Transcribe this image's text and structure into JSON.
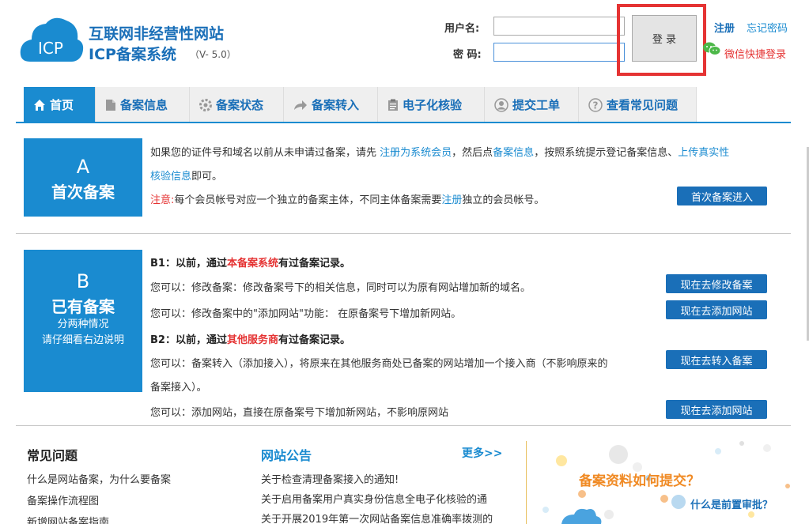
{
  "header": {
    "logo_icon_text": "ICP",
    "title_line1": "互联网非经营性网站",
    "title_line2": "ICP备案系统",
    "version": "（V- 5.0）",
    "username_label": "用户名:",
    "password_label": "密 码:",
    "username_value": "",
    "password_value": "",
    "login_label": "登 录",
    "register_link": "注册",
    "forgot_link": "忘记密码",
    "wechat_link": "微信快捷登录"
  },
  "nav": {
    "items": [
      {
        "label": "首页",
        "icon": "home-icon"
      },
      {
        "label": "备案信息",
        "icon": "document-icon"
      },
      {
        "label": "备案状态",
        "icon": "gear-icon"
      },
      {
        "label": "备案转入",
        "icon": "arrow-forward-icon"
      },
      {
        "label": "电子化核验",
        "icon": "clipboard-icon"
      },
      {
        "label": "提交工单",
        "icon": "user-icon"
      },
      {
        "label": "查看常见问题",
        "icon": "question-icon"
      }
    ]
  },
  "section_a": {
    "letter": "A",
    "title": "首次备案",
    "line1_p1": "如果您的证件号和域名以前从未申请过备案，请先 ",
    "line1_link1": "注册为系统会员",
    "line1_p2": "，然后点",
    "line1_link2": "备案信息",
    "line1_p3": "，按照系统提示登记备案信息、",
    "line1_link3": "上传真实性",
    "line2_link": "核验信息",
    "line2_p": "即可。",
    "note_label": "注意:",
    "note_p1": "每个会员帐号对应一个独立的备案主体，不同主体备案需要",
    "note_link": "注册",
    "note_p2": "独立的会员帐号。",
    "button": "首次备案进入"
  },
  "section_b": {
    "letter": "B",
    "title": "已有备案",
    "sub1": "分两种情况",
    "sub2": "请仔细看右边说明",
    "b1_p1": "B1：以前，通过",
    "b1_red": "本备案系统",
    "b1_p2": "有过备案记录。",
    "b1_line1": "您可以：修改备案：修改备案号下的相关信息，同时可以为原有网站增加新的域名。",
    "b1_line2": "您可以：修改备案中的\"添加网站\"功能：  在原备案号下增加新网站。",
    "b2_p1": "B2：以前，通过",
    "b2_red": "其他服务商",
    "b2_p2": "有过备案记录。",
    "b2_line1": "您可以：备案转入（添加接入），将原来在其他服务商处已备案的网站增加一个接入商（不影响原来的",
    "b2_line1b": "备案接入）。",
    "b2_line2": "您可以：添加网站，直接在原备案号下增加新网站，不影响原网站",
    "btn_modify": "现在去修改备案",
    "btn_add_site1": "现在去添加网站",
    "btn_transfer": "现在去转入备案",
    "btn_add_site2": "现在去添加网站"
  },
  "faq": {
    "title": "常见问题",
    "items": [
      "什么是网站备案，为什么要备案",
      "备案操作流程图",
      "新增网站备案指南"
    ]
  },
  "notices": {
    "title": "网站公告",
    "more": "更多>>",
    "items": [
      "关于检查清理备案接入的通知!",
      "关于启用备案用户真实身份信息全电子化核验的通",
      "关于开展2019年第一次网站备案信息准确率拨测的"
    ]
  },
  "promo": {
    "question1": "备案资料如何提交？",
    "question2": "什么是前置审批？"
  },
  "colors": {
    "primary": "#1a8bd0",
    "dark_blue": "#1a6fb8",
    "alert_red": "#e53333",
    "orange": "#f08a24"
  }
}
